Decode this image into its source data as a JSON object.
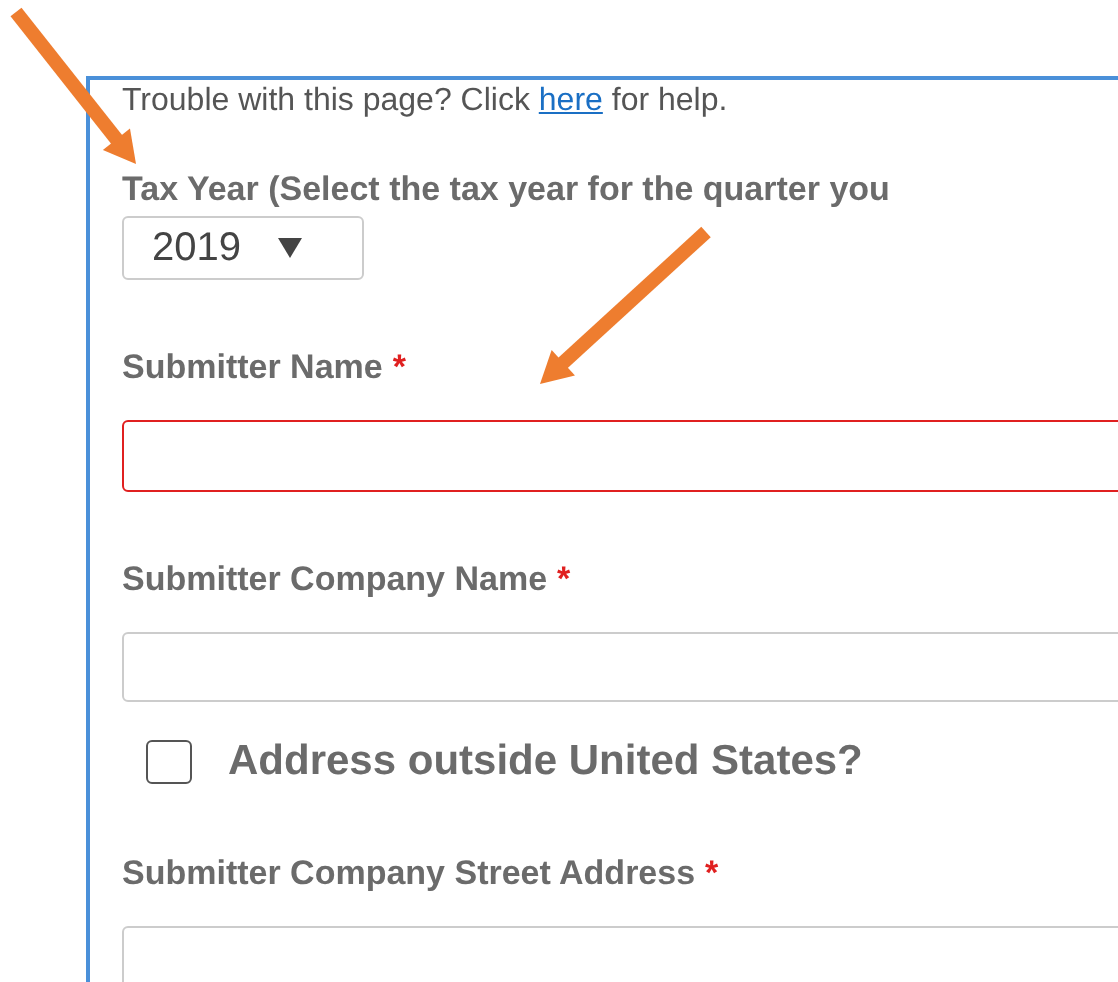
{
  "help": {
    "before": "Trouble with this page?  Click ",
    "link": "here",
    "after": " for help."
  },
  "fields": [
    {
      "kind": "select",
      "label": "Tax Year (Select the tax year for the quarter you",
      "value": "2019"
    },
    {
      "kind": "text",
      "label": "Submitter Name",
      "required_mark": "*",
      "invalid": true
    },
    {
      "kind": "text",
      "label": "Submitter Company Name",
      "required_mark": "*",
      "invalid": false
    },
    {
      "kind": "checkbox",
      "label": "Address outside United States?",
      "checked": false
    },
    {
      "kind": "text",
      "label": "Submitter Company Street Address",
      "required_mark": "*",
      "invalid": false
    }
  ]
}
